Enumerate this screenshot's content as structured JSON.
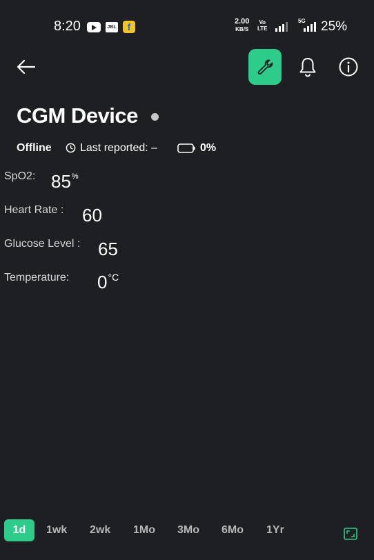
{
  "status_bar": {
    "time": "8:20",
    "speed_value": "2.00",
    "speed_unit": "KB/S",
    "volte_line1": "Vo",
    "volte_line2": "LTE",
    "network_5g": "5G",
    "battery": "25%",
    "app_icons": [
      "youtube-icon",
      "jbl-icon",
      "flipkart-icon"
    ],
    "jbl_label": "JBL",
    "flipkart_glyph": "f"
  },
  "toolbar": {
    "back_icon": "arrow-left-icon",
    "settings_icon": "wrench-icon",
    "notification_icon": "bell-icon",
    "info_icon": "info-icon",
    "accent_color": "#2ecc8a"
  },
  "device": {
    "title": "CGM Device",
    "status": "Offline",
    "last_reported": "Last reported: –",
    "battery_level": "0%"
  },
  "readings": [
    {
      "label": "SpO2:",
      "value": "85",
      "unit": "%"
    },
    {
      "label": "Heart Rate :",
      "value": "60",
      "unit": ""
    },
    {
      "label": "Glucose Level :",
      "value": "65",
      "unit": ""
    },
    {
      "label": "Temperature:",
      "value": "0",
      "unit": "°C"
    }
  ],
  "time_ranges": {
    "options": [
      "1d",
      "1wk",
      "2wk",
      "1Mo",
      "3Mo",
      "6Mo",
      "1Yr"
    ],
    "selected": "1d"
  },
  "expand_icon": "fullscreen-icon"
}
